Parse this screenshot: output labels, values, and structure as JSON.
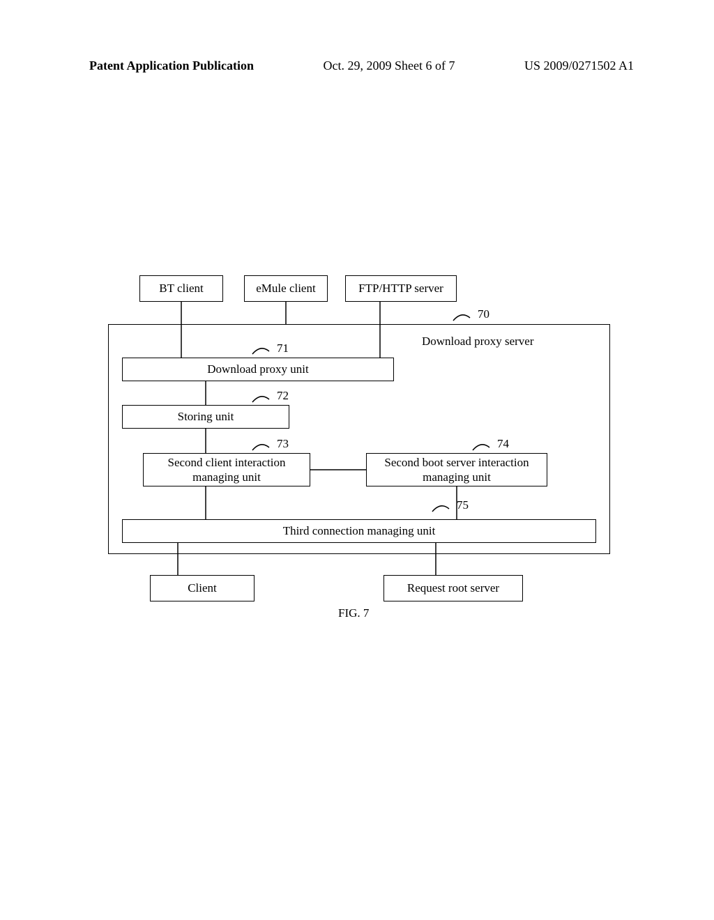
{
  "header": {
    "left": "Patent Application Publication",
    "center": "Oct. 29, 2009  Sheet 6 of 7",
    "right": "US 2009/0271502 A1"
  },
  "boxes": {
    "bt_client": "BT client",
    "emule_client": "eMule client",
    "ftp_http_server": "FTP/HTTP server",
    "download_proxy_unit": "Download proxy unit",
    "storing_unit": "Storing unit",
    "second_client": "Second client interaction\nmanaging unit",
    "second_boot": "Second boot server interaction\nmanaging unit",
    "third_conn": "Third connection managing unit",
    "client": "Client",
    "request_root": "Request root server"
  },
  "side_label": "Download proxy server",
  "refs": {
    "r70": "70",
    "r71": "71",
    "r72": "72",
    "r73": "73",
    "r74": "74",
    "r75": "75"
  },
  "caption": "FIG. 7"
}
